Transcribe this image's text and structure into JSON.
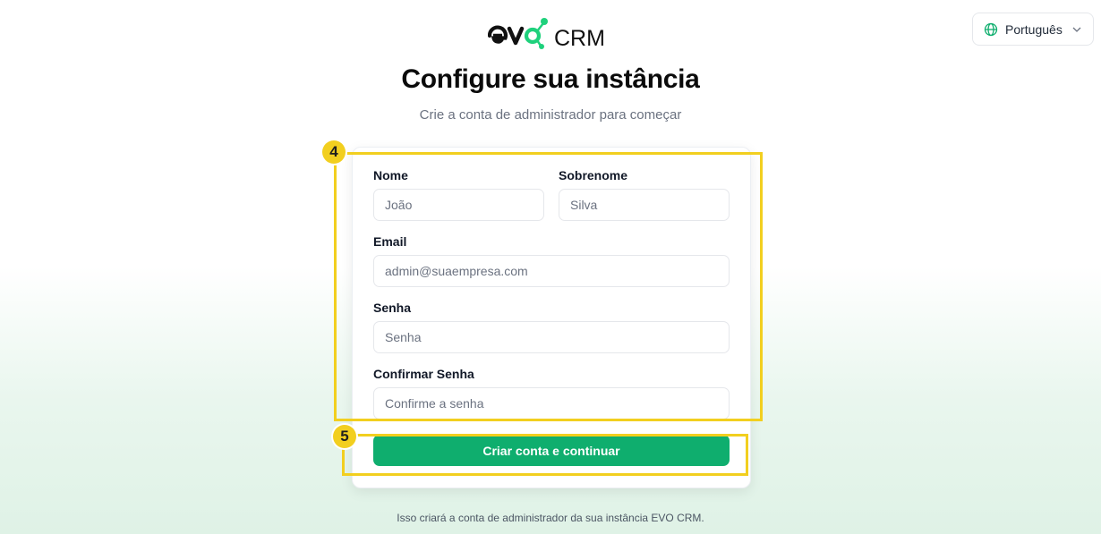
{
  "language_selector": {
    "icon": "globe-icon",
    "label": "Português",
    "chevron": "chevron-down-icon"
  },
  "brand": {
    "logo_mark": "evo",
    "product": "CRM",
    "colors": {
      "dark": "#111111",
      "accent": "#1fd17c"
    }
  },
  "header": {
    "title": "Configure sua instância",
    "subtitle": "Crie a conta de administrador para começar"
  },
  "form": {
    "first_name": {
      "label": "Nome",
      "placeholder": "João"
    },
    "last_name": {
      "label": "Sobrenome",
      "placeholder": "Silva"
    },
    "email": {
      "label": "Email",
      "placeholder": "admin@suaempresa.com"
    },
    "password": {
      "label": "Senha",
      "placeholder": "Senha"
    },
    "confirm_password": {
      "label": "Confirmar Senha",
      "placeholder": "Confirme a senha"
    },
    "submit_label": "Criar conta e continuar"
  },
  "annotations": {
    "form_badge": "4",
    "submit_badge": "5",
    "color": "#f2cf1f"
  },
  "footer": {
    "note": "Isso criará a conta de administrador da sua instância EVO CRM."
  },
  "theme": {
    "primary": "#0fae6e"
  }
}
